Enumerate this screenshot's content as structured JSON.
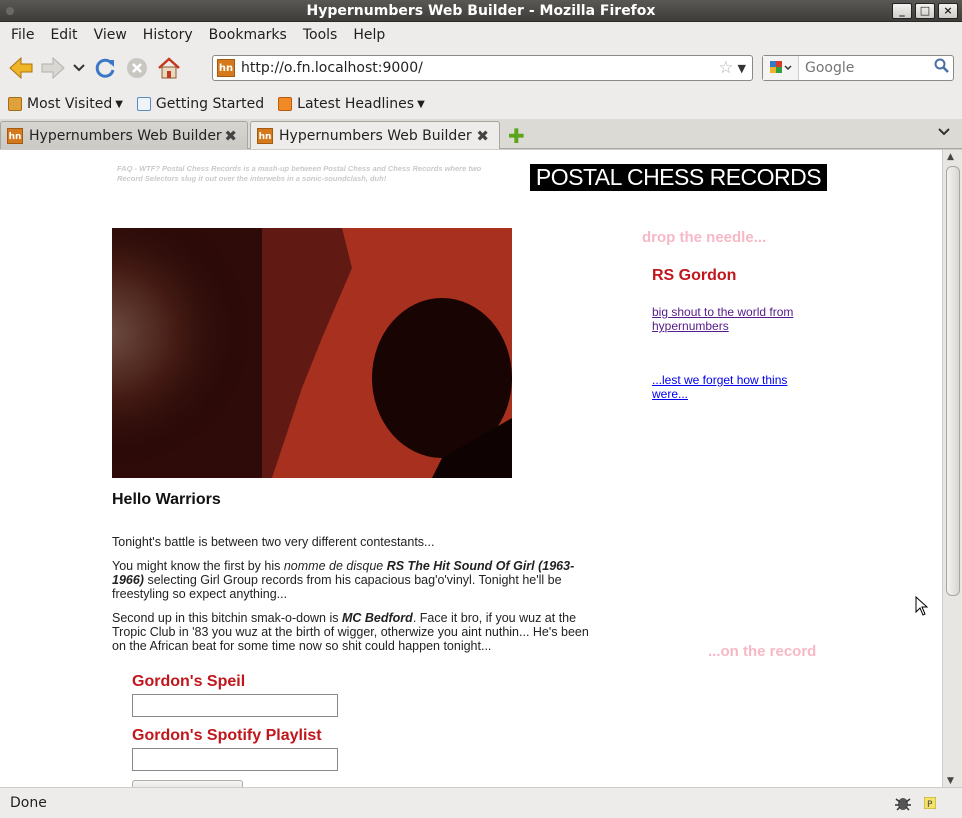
{
  "window": {
    "title": "Hypernumbers Web Builder - Mozilla Firefox"
  },
  "menu": {
    "items": [
      {
        "label": "File"
      },
      {
        "label": "Edit"
      },
      {
        "label": "View"
      },
      {
        "label": "History"
      },
      {
        "label": "Bookmarks"
      },
      {
        "label": "Tools"
      },
      {
        "label": "Help"
      }
    ]
  },
  "nav": {
    "url": "http://o.fn.localhost:9000/",
    "site_icon_text": "hn",
    "search_placeholder": "Google"
  },
  "bookmarks": {
    "items": [
      {
        "label": "Most Visited"
      },
      {
        "label": "Getting Started"
      },
      {
        "label": "Latest Headlines"
      }
    ]
  },
  "tabs": [
    {
      "label": "Hypernumbers Web Builder",
      "active": false
    },
    {
      "label": "Hypernumbers Web Builder",
      "active": true
    }
  ],
  "page": {
    "faq": "FAQ - WTF? Postal Chess Records is a mash-up between Postal Chess and Chess Records where two Record Selectors slug it out over the interwebs in a sonic-soundclash, duh!",
    "logo_text": "POSTAL CHESS RECORDS",
    "heading": "Hello Warriors",
    "para1": "Tonight's battle is between two very different contestants...",
    "para2_a": "You might know the first by his ",
    "para2_italic": "nomme de disque",
    "para2_bold": "RS The Hit Sound Of Girl (1963-1966)",
    "para2_b": " selecting Girl Group records from his capacious bag'o'vinyl. Tonight he'll be freestyling so expect anything...",
    "para3_a": "Second up in this bitchin smak-o-down is ",
    "para3_bold": "MC Bedford",
    "para3_b": ". Face it bro, if you wuz at the Tropic Club in '83 you wuz at the birth of wigger, otherwize you aint nuthin... He's been on the African beat for some time now so shit could happen tonight...",
    "form_label1": "Gordon's Speil",
    "form_label2": "Gordon's Spotify Playlist",
    "side_drop": "drop the needle...",
    "side_name": "RS Gordon",
    "side_link1": "big shout to the world from hypernumbers",
    "side_link2": "...lest we forget how thins were...",
    "side_record": "...on the record"
  },
  "status": {
    "text": "Done"
  },
  "colors": {
    "accent_red": "#c0161c",
    "pink": "#f7b8c6"
  }
}
